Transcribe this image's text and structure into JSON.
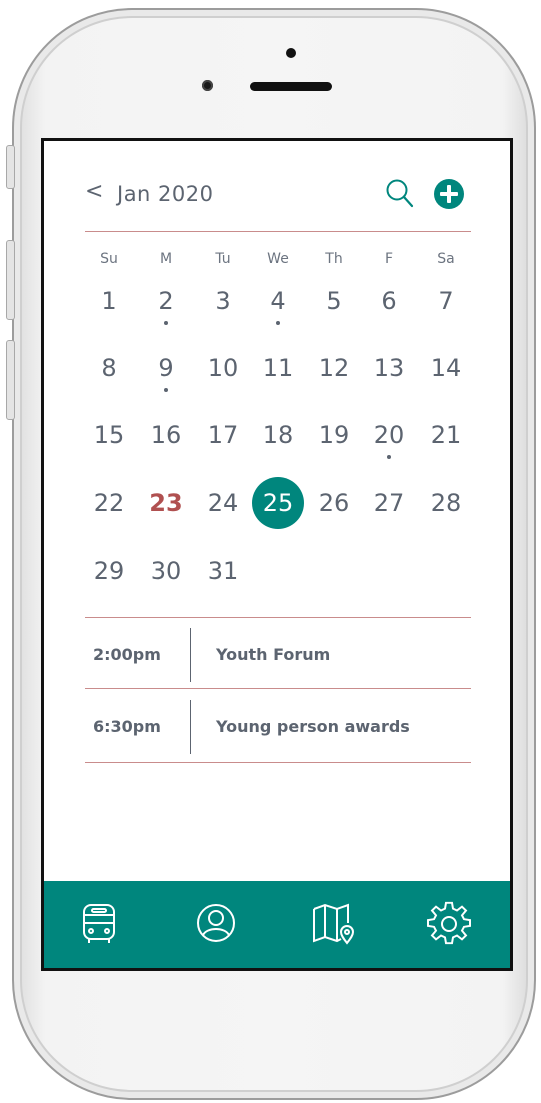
{
  "colors": {
    "accent": "#00867d",
    "text": "#5c6470",
    "today": "#b05050",
    "divider": "#c98c8c"
  },
  "header": {
    "back_label": "<",
    "month_label": "Jan 2020",
    "search_icon": "search-icon",
    "add_icon": "plus-circle-icon"
  },
  "weekdays": [
    "Su",
    "M",
    "Tu",
    "We",
    "Th",
    "F",
    "Sa"
  ],
  "calendar": {
    "weeks": [
      [
        "1",
        "2",
        "3",
        "4",
        "5",
        "6",
        "7"
      ],
      [
        "8",
        "9",
        "10",
        "11",
        "12",
        "13",
        "14"
      ],
      [
        "15",
        "16",
        "17",
        "18",
        "19",
        "20",
        "21"
      ],
      [
        "22",
        "23",
        "24",
        "25",
        "26",
        "27",
        "28"
      ],
      [
        "29",
        "30",
        "31",
        "",
        "",
        "",
        ""
      ]
    ],
    "today": "23",
    "selected": "25",
    "days_with_events": [
      "2",
      "4",
      "9",
      "20"
    ]
  },
  "events": [
    {
      "time": "2:00pm",
      "title": "Youth Forum"
    },
    {
      "time": "6:30pm",
      "title": "Young person awards"
    }
  ],
  "tabbar": {
    "items": [
      "bus-icon",
      "user-icon",
      "map-icon",
      "settings-icon"
    ]
  }
}
